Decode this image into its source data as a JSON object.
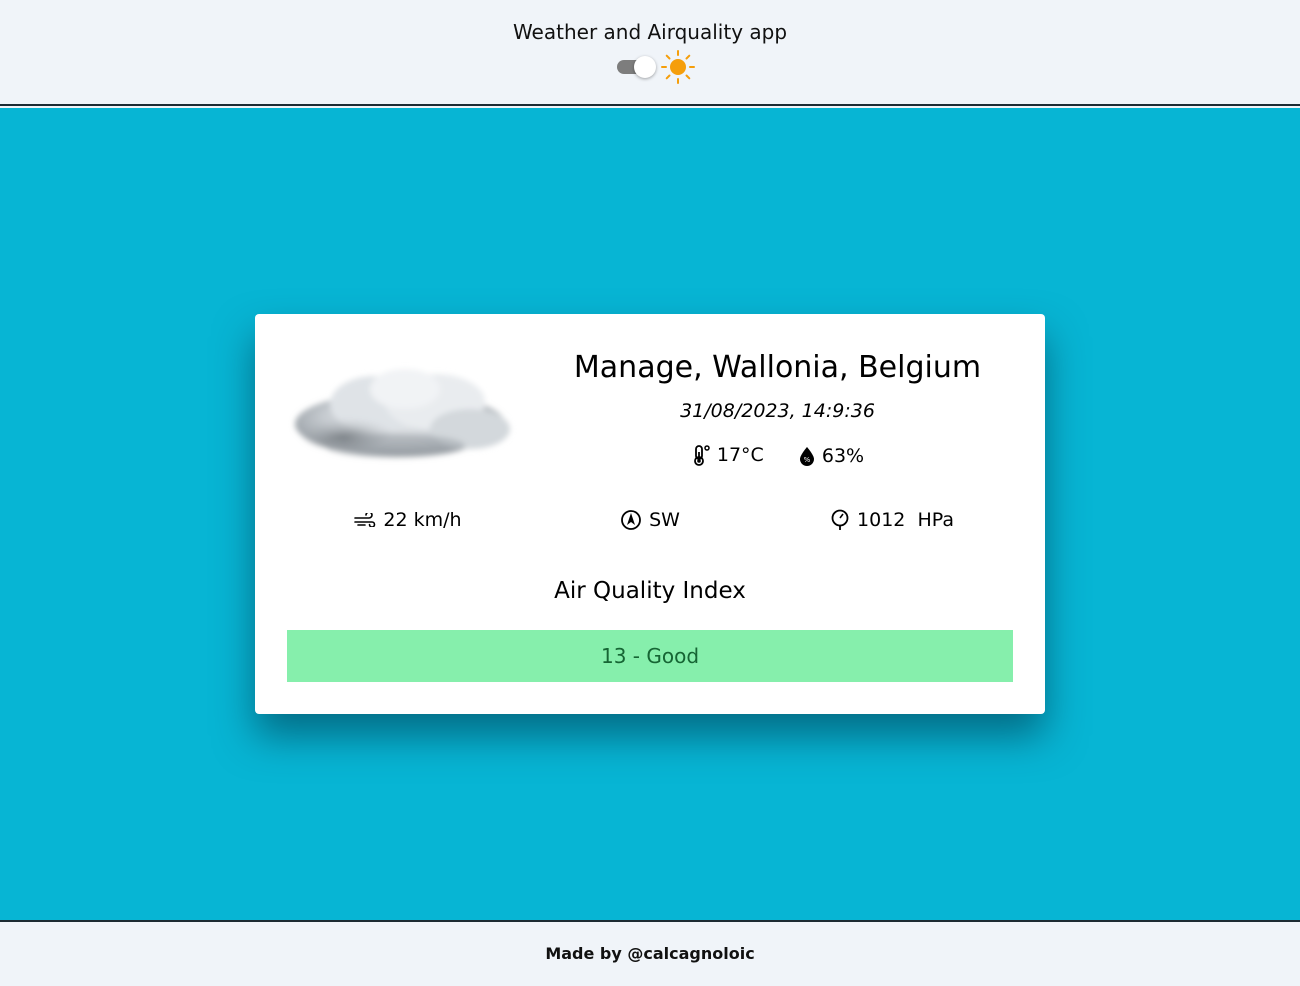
{
  "header": {
    "title": "Weather and Airquality app",
    "theme_toggle": {
      "state": "light",
      "icon": "sun-icon"
    }
  },
  "weather": {
    "condition_icon": "cloud-icon",
    "location": "Manage, Wallonia, Belgium",
    "datetime": "31/08/2023, 14:9:36",
    "temperature": "17°C",
    "humidity": "63%",
    "wind_speed": "22 km/h",
    "wind_direction": "SW",
    "pressure": "1012  HPa"
  },
  "air_quality": {
    "title": "Air Quality Index",
    "value_label": "13 - Good",
    "status_color": "#86efac"
  },
  "footer": {
    "credit": "Made by @calcagnoloic"
  },
  "colors": {
    "background": "#07b5d4",
    "header_bg": "#f0f4f9",
    "sun": "#f59e0b"
  }
}
